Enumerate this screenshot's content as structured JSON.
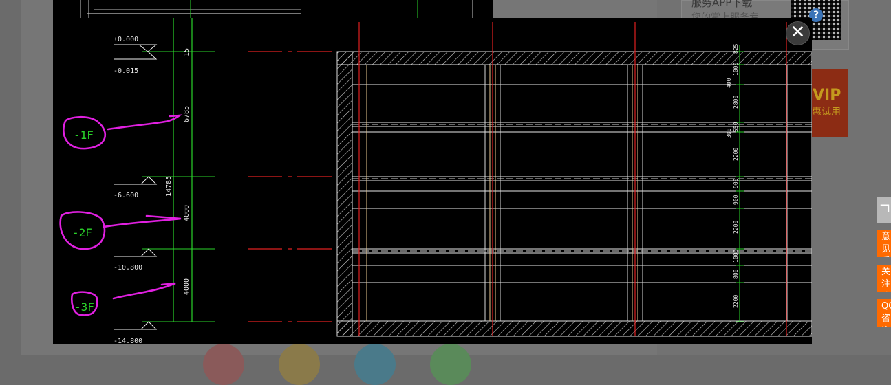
{
  "background_page": {
    "app_download_text": "服务APP下载",
    "app_download_sub": "您的掌上服务专",
    "qr_badge": "?",
    "vip_title": "VIP",
    "vip_sub": "惠试用"
  },
  "floating_toolbar": {
    "top_label": "ㄱ",
    "feedback_label": "意见反馈",
    "follow_label": "关注我们",
    "qq_label": "QQ咨询"
  },
  "viewer": {
    "close_label": "✕"
  },
  "drawing": {
    "elevations": [
      "±0.000",
      "-0.015",
      "-6.600",
      "-10.800",
      "-14.800"
    ],
    "dims_left": [
      "15",
      "6785",
      "14785",
      "4000",
      "4000"
    ],
    "floor_labels": [
      "-1F",
      "-2F",
      "-3F"
    ],
    "dims_right": [
      "825",
      "1000",
      "400",
      "2800",
      "550",
      "300",
      "2200",
      "900",
      "900",
      "2200",
      "1000",
      "800",
      "2200"
    ]
  }
}
